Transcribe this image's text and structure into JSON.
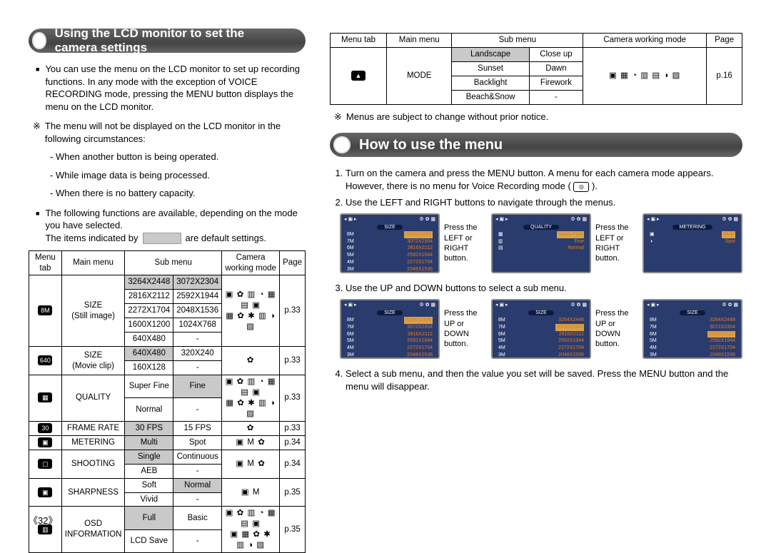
{
  "page_number": "《32》",
  "headings": {
    "h1": "Using the LCD monitor to set the camera settings",
    "h2": "How to use the menu"
  },
  "left": {
    "intro": "You can use the menu on the LCD monitor to set up recording functions. In any mode with the exception of VOICE RECORDING mode, pressing the MENU button displays the menu on the LCD monitor.",
    "note": "The menu will not be displayed on the LCD monitor in the following circumstances:",
    "note_items": [
      "- When another button is being operated.",
      "- While image data is being processed.",
      "- When there is no battery capacity."
    ],
    "functions_intro": "The following functions are available, depending on the mode you have selected.",
    "defaults_pre": "The items indicated by",
    "defaults_post": "are default settings.",
    "table": {
      "headers": [
        "Menu tab",
        "Main menu",
        "Sub menu",
        "Camera working mode",
        "Page"
      ],
      "rows": [
        {
          "tab": "8M",
          "main": "SIZE\n(Still image)",
          "sub": [
            [
              "3264X2448",
              "3072X2304",
              "shade"
            ],
            [
              "2816X2112",
              "2592X1944",
              ""
            ],
            [
              "2272X1704",
              "2048X1536",
              ""
            ],
            [
              "1600X1200",
              "1024X768",
              ""
            ],
            [
              "640X480",
              "-",
              ""
            ]
          ],
          "mode": "▣ ✿ ▥ ◔ ▦ ▤ ▣\n▦ ✿ ✱ ▥ ◑ ▧",
          "page": "p.33"
        },
        {
          "tab": "640",
          "main": "SIZE\n(Movie clip)",
          "sub": [
            [
              "640X480",
              "320X240",
              "shade"
            ],
            [
              "160X128",
              "-",
              ""
            ]
          ],
          "mode": "✿",
          "page": "p.33"
        },
        {
          "tab": "▦",
          "main": "QUALITY",
          "sub": [
            [
              "Super Fine",
              "Fine",
              "shade-right"
            ],
            [
              "Normal",
              "-",
              ""
            ]
          ],
          "mode": "▣ ✿ ▥ ◔ ▦ ▤ ▣\n▦ ✿ ✱ ▥ ◑ ▧",
          "page": "p.33"
        },
        {
          "tab": "30",
          "main": "FRAME RATE",
          "sub": [
            [
              "30 FPS",
              "15 FPS",
              "shade-left"
            ]
          ],
          "mode": "✿",
          "page": "p.33"
        },
        {
          "tab": "▣",
          "main": "METERING",
          "sub": [
            [
              "Multi",
              "Spot",
              "shade-left"
            ]
          ],
          "mode": "▣  M  ✿",
          "page": "p.34"
        },
        {
          "tab": "▢",
          "main": "SHOOTING",
          "sub": [
            [
              "Single",
              "Continuous",
              "shade-left"
            ],
            [
              "AEB",
              "-",
              ""
            ]
          ],
          "mode": "▣  M  ✿",
          "page": "p.34"
        },
        {
          "tab": "▣",
          "main": "SHARPNESS",
          "sub": [
            [
              "Soft",
              "Normal",
              "shade-right"
            ],
            [
              "Vivid",
              "-",
              ""
            ]
          ],
          "mode": "▣   M",
          "page": "p.35"
        },
        {
          "tab": "▥",
          "main": "OSD\nINFORMATION",
          "sub": [
            [
              "Full",
              "Basic",
              "shade-left"
            ],
            [
              "LCD Save",
              "-",
              ""
            ]
          ],
          "mode": "▣ ✿ ▥ ◔ ▦ ▤ ▣\n▣ ▦ ✿ ✱ ▥ ◑ ▧",
          "page": "p.35"
        }
      ]
    }
  },
  "right": {
    "table": {
      "headers": [
        "Menu tab",
        "Main menu",
        "Sub menu",
        "Camera working mode",
        "Page"
      ],
      "main": "MODE",
      "rows": [
        [
          "Landscape",
          "Close up"
        ],
        [
          "Sunset",
          "Dawn"
        ],
        [
          "Backlight",
          "Firework"
        ],
        [
          "Beach&Snow",
          "-"
        ]
      ],
      "mode": "▣ ▦ ◔ ▥ ▤ ◑ ▧",
      "page": "p.16",
      "tab_icon": "▲"
    },
    "note": "Menus are subject to change without prior notice.",
    "steps": {
      "s1": "Turn on the camera and press the MENU button. A menu for each camera mode appears. However, there is no menu for Voice Recording mode (",
      "s1_end": ").",
      "s2": "Use the LEFT and RIGHT buttons to navigate through the menus.",
      "s3": "Use the UP and DOWN buttons to select a sub menu.",
      "s4": "Select a sub menu, and then the value you set will be saved. Press the MENU button and the menu will disappear."
    },
    "annot_lr": "Press the LEFT or RIGHT button.",
    "annot_ud": "Press the UP or DOWN button.",
    "screens_top": [
      {
        "title": "SIZE",
        "rows": [
          [
            "8M",
            "3264X2448",
            "hl"
          ],
          [
            "7M",
            "3072X2304",
            ""
          ],
          [
            "6M",
            "2816X2112",
            ""
          ],
          [
            "5M",
            "2592X1944",
            ""
          ],
          [
            "4M",
            "2272X1704",
            ""
          ],
          [
            "3M",
            "2048X1536",
            ""
          ]
        ]
      },
      {
        "title": "QUALITY",
        "rows": [
          [
            "▦",
            "Super Fine",
            "hl"
          ],
          [
            "▥",
            "Fine",
            ""
          ],
          [
            "▤",
            "Normal",
            ""
          ]
        ]
      },
      {
        "title": "METERING",
        "rows": [
          [
            "▣",
            "Multi",
            "hl"
          ],
          [
            "◑",
            "Spot",
            ""
          ]
        ]
      }
    ],
    "screens_bottom": [
      {
        "title": "SIZE",
        "sel": "8M",
        "rows": [
          [
            "8M",
            "3264X2448",
            "hl"
          ],
          [
            "7M",
            "3072X2304",
            ""
          ],
          [
            "6M",
            "2816X2112",
            ""
          ],
          [
            "5M",
            "2592X1944",
            ""
          ],
          [
            "4M",
            "2272X1704",
            ""
          ],
          [
            "3M",
            "2048X1536",
            ""
          ]
        ]
      },
      {
        "title": "SIZE",
        "sel": "7M",
        "rows": [
          [
            "8M",
            "3264X2448",
            ""
          ],
          [
            "7M",
            "3072X2304",
            "hl"
          ],
          [
            "6M",
            "2816X2112",
            ""
          ],
          [
            "5M",
            "2592X1944",
            ""
          ],
          [
            "4M",
            "2272X1704",
            ""
          ],
          [
            "3M",
            "2048X1536",
            ""
          ]
        ]
      },
      {
        "title": "SIZE",
        "sel": "6M",
        "rows": [
          [
            "8M",
            "3264X2448",
            ""
          ],
          [
            "7M",
            "3072X2304",
            ""
          ],
          [
            "6M",
            "2816X2112",
            "hl"
          ],
          [
            "5M",
            "2592X1944",
            ""
          ],
          [
            "4M",
            "2272X1704",
            ""
          ],
          [
            "3M",
            "2048X1536",
            ""
          ]
        ]
      }
    ]
  }
}
